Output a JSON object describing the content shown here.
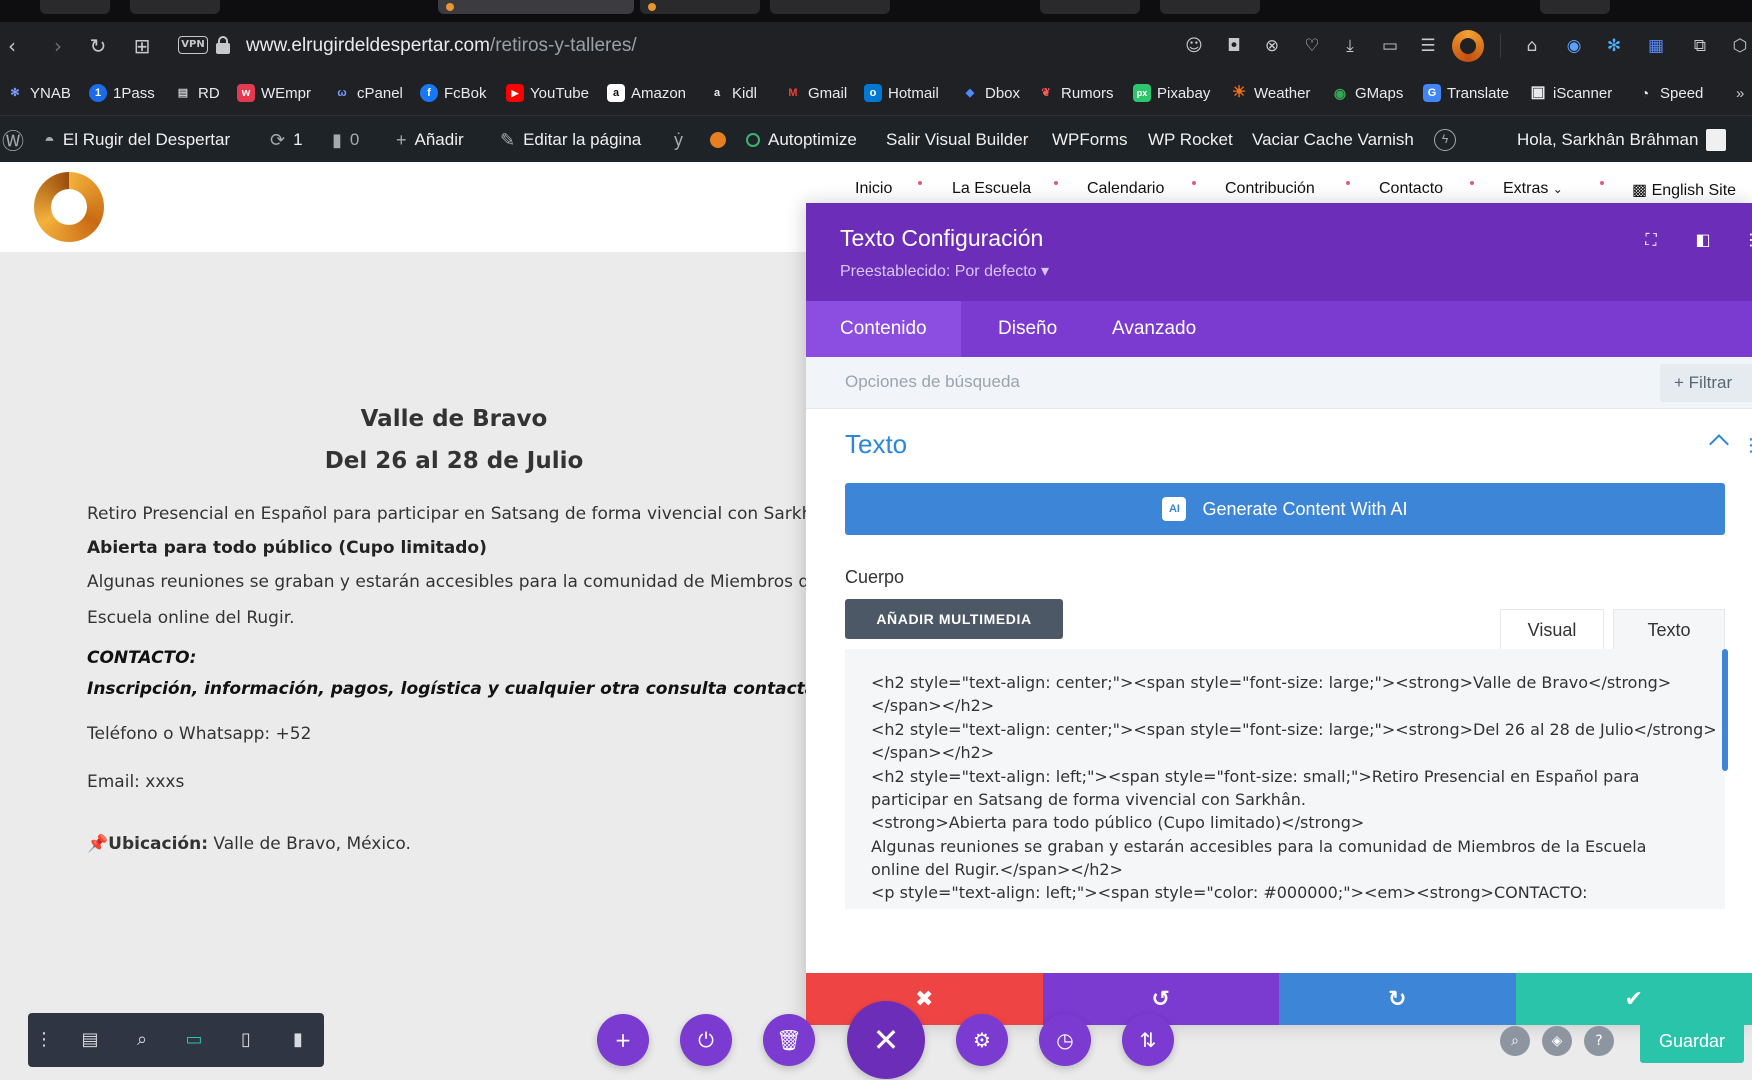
{
  "browser": {
    "url_host": "www.elrugirdeldespertar.com",
    "url_path": "/retiros-y-talleres/",
    "vpn_label": "VPN"
  },
  "bookmarks": [
    {
      "label": "YNAB",
      "color": "#4a6cf7",
      "glyph": "✻"
    },
    {
      "label": "1Pass",
      "color": "#1a6ce8",
      "glyph": "1"
    },
    {
      "label": "RD",
      "color": "#9aa0a6",
      "glyph": "▤"
    },
    {
      "label": "WEmpr",
      "color": "#e53950",
      "glyph": "w"
    },
    {
      "label": "cPanel",
      "color": "#3b5bd6",
      "glyph": "ω"
    },
    {
      "label": "FcBok",
      "color": "#1877f2",
      "glyph": "f"
    },
    {
      "label": "YouTube",
      "color": "#ff0000",
      "glyph": "▶"
    },
    {
      "label": "Amazon",
      "color": "#ffffff",
      "glyph": "a"
    },
    {
      "label": "Kidl",
      "color": "#e8eaed",
      "glyph": "a"
    },
    {
      "label": "Gmail",
      "color": "#ea4335",
      "glyph": "M"
    },
    {
      "label": "Hotmail",
      "color": "#0078d4",
      "glyph": "o"
    },
    {
      "label": "Dbox",
      "color": "#0061ff",
      "glyph": "◆"
    },
    {
      "label": "Rumors",
      "color": "#d93025",
      "glyph": "❦"
    },
    {
      "label": "Pixabay",
      "color": "#2ec66d",
      "glyph": "px"
    },
    {
      "label": "Weather",
      "color": "#f0701a",
      "glyph": "☀"
    },
    {
      "label": "GMaps",
      "color": "#34a853",
      "glyph": "◉"
    },
    {
      "label": "Translate",
      "color": "#4285f4",
      "glyph": "G"
    },
    {
      "label": "iScanner",
      "color": "#e8eaed",
      "glyph": "▣"
    },
    {
      "label": "Speed",
      "color": "#e8eaed",
      "glyph": "◔"
    }
  ],
  "wpbar": {
    "site_name": "El Rugir del Despertar",
    "updates_count": "1",
    "comments_count": "0",
    "add_new": "Añadir",
    "edit_page": "Editar la página",
    "autoptimize": "Autoptimize",
    "exit_builder": "Salir Visual Builder",
    "wpforms": "WPForms",
    "wp_rocket": "WP Rocket",
    "varnish": "Vaciar Cache Varnish",
    "greeting": "Hola, Sarkhân Brâhman"
  },
  "site_nav": [
    "Inicio",
    "La Escuela",
    "Calendario",
    "Contribución",
    "Contacto",
    "Extras",
    "English Site"
  ],
  "page": {
    "heading1": "Valle de Bravo",
    "heading2": "Del 26 al 28 de Julio",
    "intro": "Retiro Presencial en Español para participar en Satsang de forma vivencial con Sarkhân.",
    "open_to_all": "Abierta para todo público (Cupo limitado)",
    "recordings_1": "Algunas reuniones se graban y estarán accesibles para la comunidad de Miembros de la",
    "recordings_2": "Escuela online del Rugir.",
    "contact_label": "CONTACTO:",
    "contact_text": "Inscripción, información, pagos, logística y cualquier otra consulta contactar a:",
    "phone": "Teléfono o Whatsapp: +52",
    "email": "Email: xxxs",
    "location_label": "Ubicación:",
    "location_value": " Valle de Bravo, México."
  },
  "modal": {
    "title": "Texto Configuración",
    "preset": "Preestablecido: Por defecto ▾",
    "tabs": [
      "Contenido",
      "Diseño",
      "Avanzado"
    ],
    "search_placeholder": "Opciones de búsqueda",
    "filter": "Filtrar",
    "section_title": "Texto",
    "ai_button": "Generate Content With AI",
    "ai_badge": "AI",
    "body_label": "Cuerpo",
    "add_media": "AÑADIR MULTIMEDIA",
    "editor_tabs": [
      "Visual",
      "Texto"
    ],
    "code_lines": [
      "<h2 style=\"text-align: center;\"><span style=\"font-size: large;\"><strong>Valle de Bravo</strong>",
      "</span></h2>",
      "<h2 style=\"text-align: center;\"><span style=\"font-size: large;\"><strong>Del 26 al 28 de Julio</strong>",
      "</span></h2>",
      "<h2 style=\"text-align: left;\"><span style=\"font-size: small;\">Retiro Presencial en Español para",
      "participar en Satsang de forma vivencial con Sarkhân.",
      "<strong>Abierta para todo público (Cupo limitado)</strong>",
      "Algunas reuniones se graban y estarán accesibles para la comunidad de Miembros de la Escuela",
      "online del Rugir.</span></h2>",
      "<p style=\"text-align: left;\"><span style=\"color: #000000;\"><em><strong>CONTACTO:"
    ]
  },
  "footer": {
    "save": "Guardar"
  },
  "colors": {
    "divi_purple": "#6c2eb9",
    "divi_blue": "#3d85d6",
    "divi_red": "#ef4444",
    "divi_green": "#29c4a9"
  }
}
